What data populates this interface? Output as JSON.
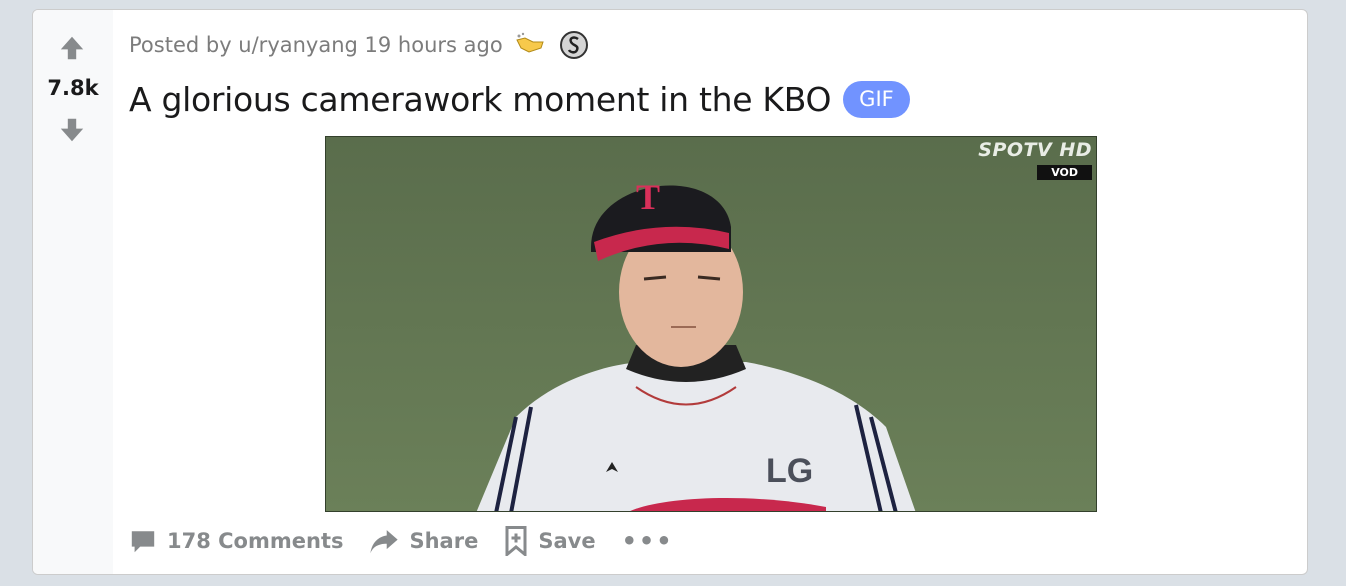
{
  "post": {
    "score": "7.8k",
    "posted_by": "Posted by u/ryanyang 19 hours ago",
    "title": "A glorious camerawork moment in the KBO",
    "flair": "GIF",
    "flair_color": "#7193ff",
    "awards": [
      "helping-hand-award-icon",
      "silver-award-icon"
    ],
    "media": {
      "watermark_logo": "SPOTV HD",
      "watermark_badge": "VOD",
      "jersey_text": "LG"
    },
    "actions": {
      "comments": "178 Comments",
      "share": "Share",
      "save": "Save",
      "more": "•••"
    }
  }
}
